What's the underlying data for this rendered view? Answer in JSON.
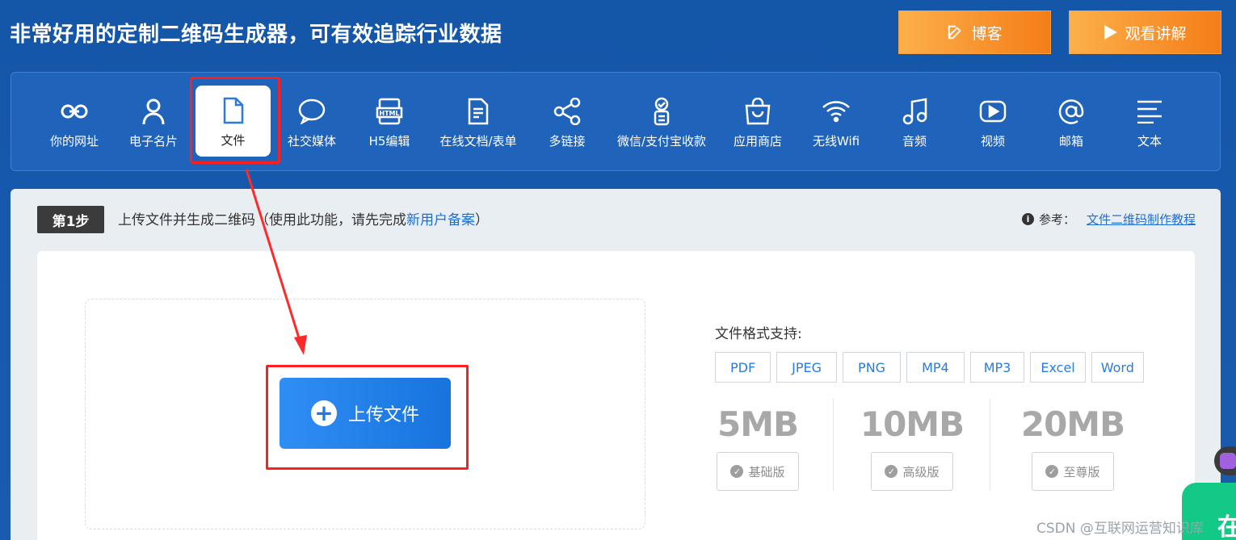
{
  "header": {
    "title": "非常好用的定制二维码生成器，可有效追踪行业数据",
    "blog_label": "博客",
    "video_label": "观看讲解"
  },
  "tabs": [
    {
      "label": "你的网址",
      "icon": "link-icon"
    },
    {
      "label": "电子名片",
      "icon": "person-icon"
    },
    {
      "label": "文件",
      "icon": "file-icon",
      "active": true
    },
    {
      "label": "社交媒体",
      "icon": "chat-bubble-icon"
    },
    {
      "label": "H5编辑",
      "icon": "html-icon"
    },
    {
      "label": "在线文档/表单",
      "icon": "document-icon"
    },
    {
      "label": "多链接",
      "icon": "share-icon"
    },
    {
      "label": "微信/支付宝收款",
      "icon": "payment-icon"
    },
    {
      "label": "应用商店",
      "icon": "shopping-bag-icon"
    },
    {
      "label": "无线Wifi",
      "icon": "wifi-icon"
    },
    {
      "label": "音频",
      "icon": "music-icon"
    },
    {
      "label": "视频",
      "icon": "play-icon"
    },
    {
      "label": "邮箱",
      "icon": "at-icon"
    },
    {
      "label": "文本",
      "icon": "text-lines-icon"
    }
  ],
  "step": {
    "badge": "第1步",
    "text": "上传文件并生成二维码（使用此功能，请先完成",
    "link": "新用户备案",
    "text_end": "）"
  },
  "reference": {
    "label": "参考：",
    "link": "文件二维码制作教程"
  },
  "upload": {
    "button_label": "上传文件"
  },
  "formats": {
    "label": "文件格式支持:",
    "items": [
      "PDF",
      "JPEG",
      "PNG",
      "MP4",
      "MP3",
      "Excel",
      "Word"
    ]
  },
  "tiers": [
    {
      "size": "5MB",
      "name": "基础版"
    },
    {
      "size": "10MB",
      "name": "高级版"
    },
    {
      "size": "20MB",
      "name": "至尊版"
    }
  ],
  "watermark": "CSDN @互联网运营知识库",
  "float_text": "在",
  "colors": {
    "header_bg": "#1456a8",
    "orange_button": "#f57d18",
    "upload_blue": "#1873dd",
    "highlight_red": "#ff1e1e",
    "link_blue": "#1e6fd9"
  }
}
